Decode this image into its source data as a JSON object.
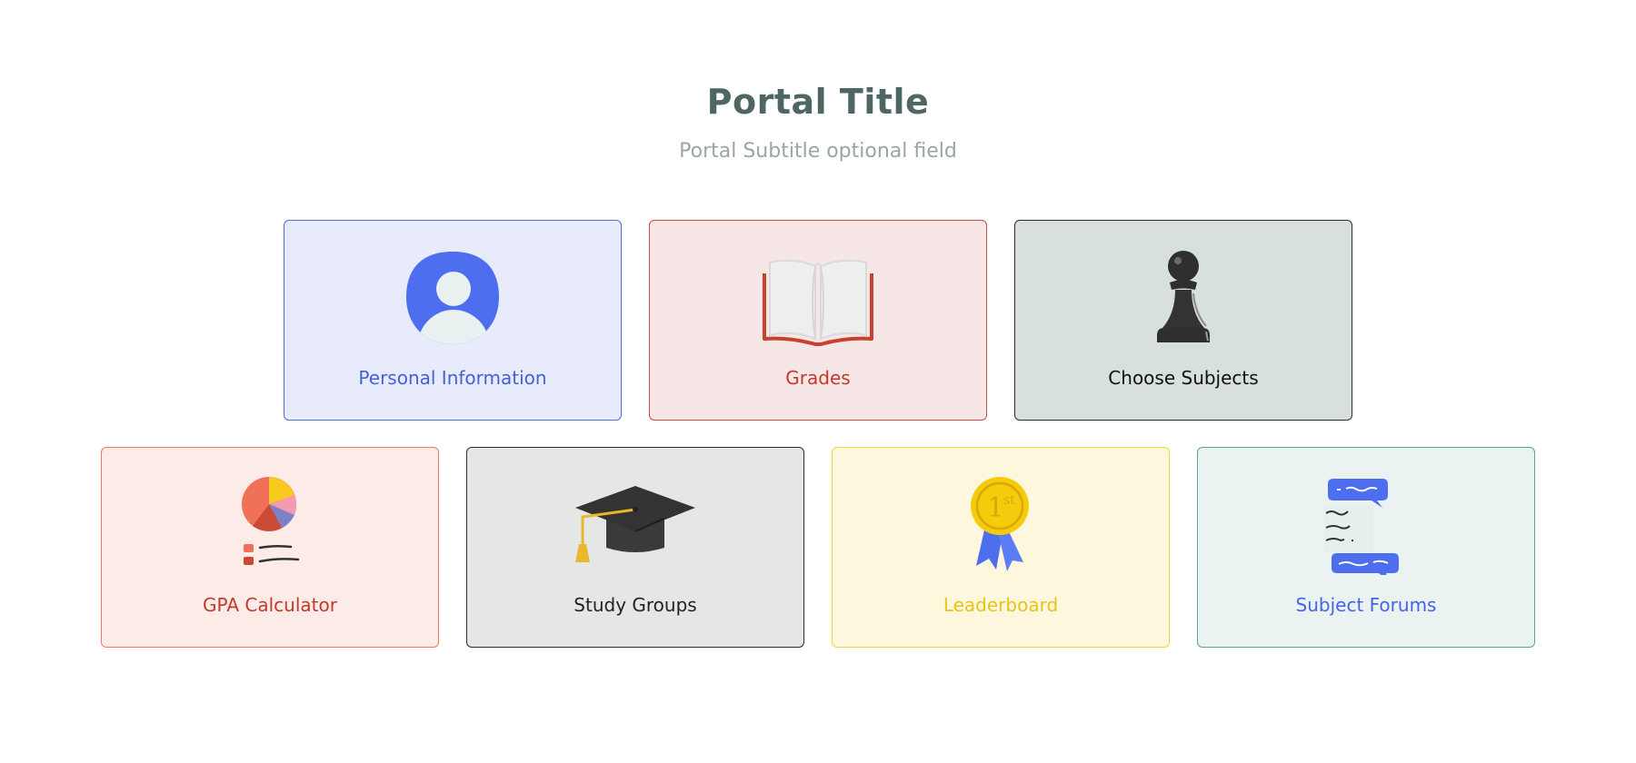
{
  "header": {
    "title": "Portal Title",
    "subtitle": "Portal Subtitle optional field"
  },
  "cards": [
    {
      "label": "Personal Information",
      "icon": "user-avatar-icon",
      "color": "#4e6ee8",
      "background": "#e8ebfb"
    },
    {
      "label": "Grades",
      "icon": "open-book-icon",
      "color": "#d04a3e",
      "background": "#f6e6e6"
    },
    {
      "label": "Choose Subjects",
      "icon": "chess-pawn-icon",
      "color": "#2c2c2c",
      "background": "#d8e0df"
    },
    {
      "label": "GPA Calculator",
      "icon": "pie-chart-icon",
      "color": "#ef7b5f",
      "background": "#fdebe7"
    },
    {
      "label": "Study Groups",
      "icon": "graduation-cap-icon",
      "color": "#2c2c2c",
      "background": "#e6e6e6"
    },
    {
      "label": "Leaderboard",
      "icon": "first-place-medal-icon",
      "color": "#f3d63a",
      "background": "#fdf8dd"
    },
    {
      "label": "Subject Forums",
      "icon": "chat-bubbles-icon",
      "color": "#5aa39a",
      "background": "#ebf2f2"
    }
  ]
}
